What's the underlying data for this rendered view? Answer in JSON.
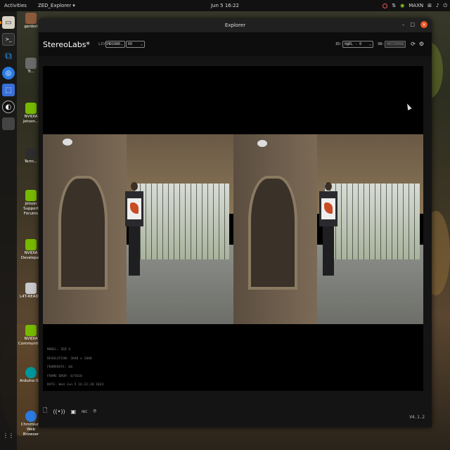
{
  "topbar": {
    "activities": "Activities",
    "app_menu": "ZED_Explorer",
    "clock": "Jun 5  16:22",
    "nvidia_mode": "MAXN"
  },
  "dock": {
    "items": [
      "files-icon",
      "terminal-icon",
      "vscode-icon",
      "chromium-icon",
      "screenshot-icon",
      "obs-icon",
      "apps-icon"
    ]
  },
  "desktop": {
    "icons": [
      {
        "label": "genbot",
        "icon": "home-folder-icon"
      },
      {
        "label": "Tr...",
        "icon": "trash-icon"
      },
      {
        "label": "NVIDIA Jetson...",
        "icon": "nvidia-icon"
      },
      {
        "label": "Term...",
        "icon": "terminal-icon"
      },
      {
        "label": "Jetson Support Forums",
        "icon": "nvidia-icon"
      },
      {
        "label": "NVIDIA Developer",
        "icon": "nvidia-icon"
      },
      {
        "label": "L4T-READ...",
        "icon": "folder-icon"
      },
      {
        "label": "NVIDIA Community...",
        "icon": "nvidia-icon"
      },
      {
        "label": "Arduino IDE",
        "icon": "arduino-icon"
      },
      {
        "label": "Chromium Web Browser",
        "icon": "chromium-icon"
      }
    ]
  },
  "window": {
    "title": "Explorer",
    "controls": {
      "minimize": "–",
      "maximize": "□",
      "close": "×"
    }
  },
  "toolbar": {
    "brand": "StereoLabs*",
    "live": "LIVE",
    "resolution": "HD1080",
    "fps": "60",
    "id_label": "ID:",
    "id_value": "0@EL - 0",
    "sn_label": "SN:",
    "sn_value": "48729998"
  },
  "overlay": {
    "model": "MODEL: ZED X",
    "resolution": "RESOLUTION: 3840 x 1080",
    "framerate": "FRAMERATE: 60",
    "frame_drop": "FRAME DROP: 0/5618",
    "date": "DATE: Wed Jun 5 16:22:28 2024"
  },
  "bottombar": {
    "rec_label": "REC",
    "version": "V4.1.2"
  }
}
